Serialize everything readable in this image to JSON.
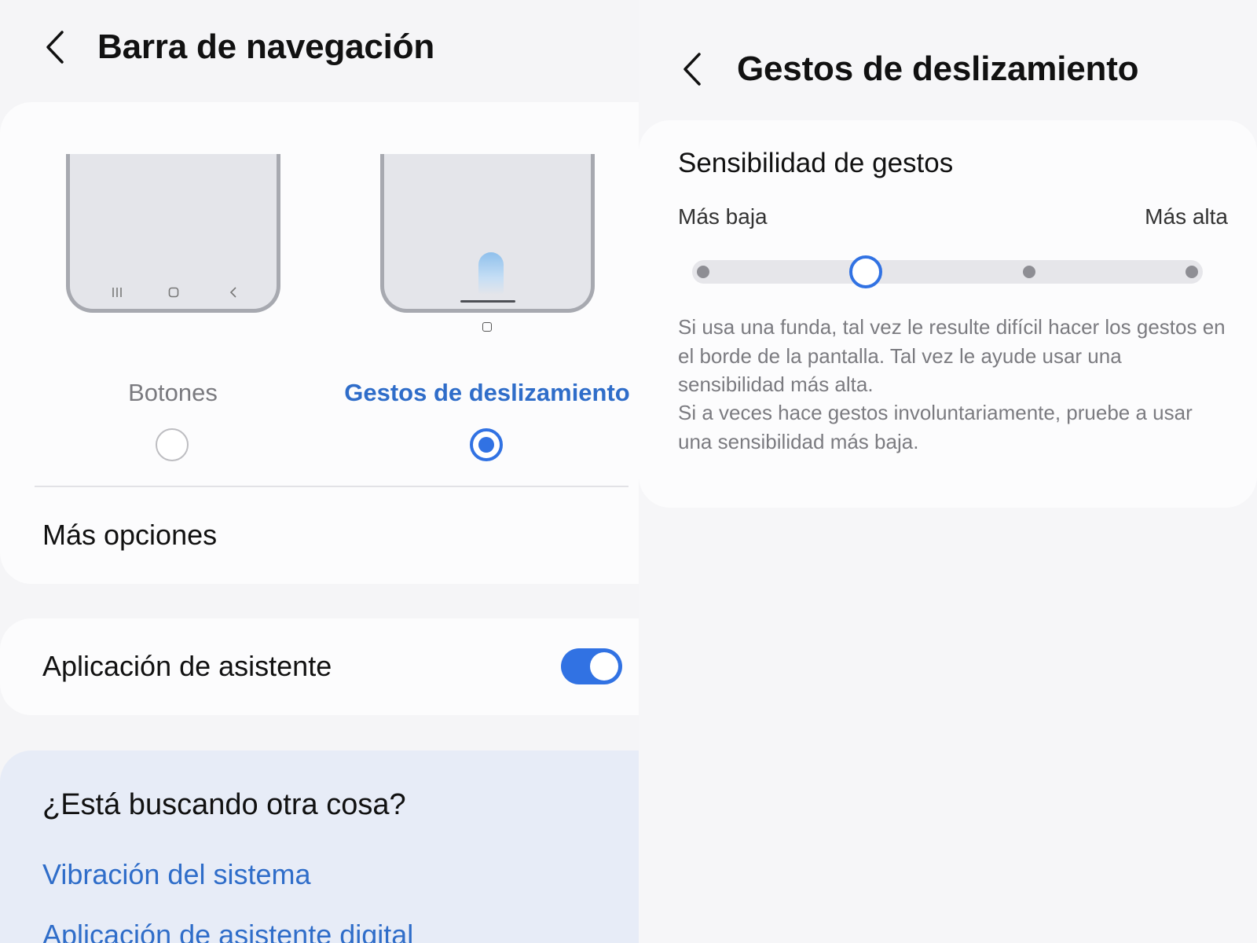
{
  "left": {
    "header": {
      "title": "Barra de navegación",
      "back_icon": "chevron-left-icon"
    },
    "nav_types": {
      "options": [
        {
          "label": "Botones",
          "selected": false,
          "preview": "three-buttons"
        },
        {
          "label": "Gestos de deslizamiento",
          "selected": true,
          "preview": "swipe-gestures"
        }
      ]
    },
    "more_options": {
      "label": "Más opciones"
    },
    "assistant": {
      "label": "Aplicación de asistente",
      "enabled": true
    },
    "suggestions": {
      "title": "¿Está buscando otra cosa?",
      "links": [
        "Vibración del sistema",
        "Aplicación de asistente digital"
      ]
    }
  },
  "right": {
    "header": {
      "title": "Gestos de deslizamiento",
      "back_icon": "chevron-left-icon"
    },
    "sensitivity": {
      "title": "Sensibilidad de gestos",
      "min_label": "Más baja",
      "max_label": "Más alta",
      "steps": 4,
      "selected_step": 2
    },
    "help": {
      "paragraph1": "Si usa una funda, tal vez le resulte difícil hacer los gestos en el borde de la pantalla. Tal vez le ayude usar una sensibilidad más alta.",
      "paragraph2": "Si a veces hace gestos involuntariamente, pruebe a usar una sensibilidad más baja."
    }
  },
  "colors": {
    "accent": "#3172e3",
    "link": "#2f6dc9",
    "card": "#fcfcfd",
    "suggestion_card": "#e7ecf7",
    "background": "#f5f5f7",
    "muted_text": "#7b7b80"
  }
}
